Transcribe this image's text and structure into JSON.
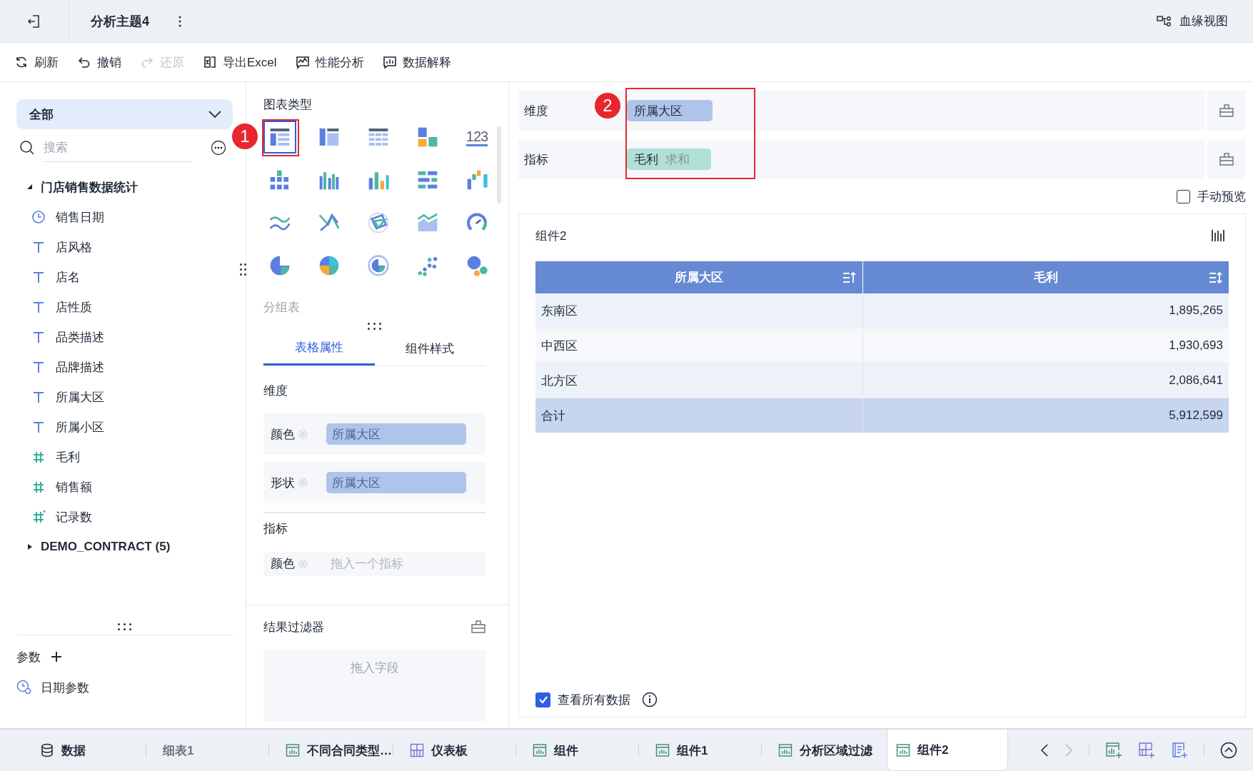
{
  "header": {
    "title": "分析主题4",
    "lineage_label": "血缘视图"
  },
  "toolbar": [
    {
      "label": "刷新",
      "kind": "refresh",
      "disabled": false
    },
    {
      "label": "撤销",
      "kind": "undo",
      "disabled": false
    },
    {
      "label": "还原",
      "kind": "redo",
      "disabled": true
    },
    {
      "label": "导出Excel",
      "kind": "excel",
      "disabled": false
    },
    {
      "label": "性能分析",
      "kind": "performance",
      "disabled": false
    },
    {
      "label": "数据解释",
      "kind": "explain",
      "disabled": false
    }
  ],
  "data_panel": {
    "scope": "全部",
    "search_placeholder": "搜索",
    "datasets": [
      {
        "name": "门店销售数据统计",
        "expanded": true,
        "children": [
          {
            "name": "销售日期",
            "kind": "date"
          },
          {
            "name": "店风格",
            "kind": "text"
          },
          {
            "name": "店名",
            "kind": "text"
          },
          {
            "name": "店性质",
            "kind": "text"
          },
          {
            "name": "品类描述",
            "kind": "text"
          },
          {
            "name": "品牌描述",
            "kind": "text"
          },
          {
            "name": "所属大区",
            "kind": "text"
          },
          {
            "name": "所属小区",
            "kind": "text"
          },
          {
            "name": "毛利",
            "kind": "number"
          },
          {
            "name": "销售额",
            "kind": "number"
          },
          {
            "name": "记录数",
            "kind": "count"
          }
        ]
      },
      {
        "name": "DEMO_CONTRACT (5)",
        "expanded": false
      }
    ],
    "params_label": "参数",
    "params": [
      {
        "name": "日期参数",
        "kind": "date"
      }
    ]
  },
  "chart_types": {
    "title": "图表类型",
    "hint": "分组表",
    "items": [
      {
        "kind": "table",
        "selected": true
      },
      {
        "kind": "crosstab",
        "selected": false
      },
      {
        "kind": "grid",
        "selected": false
      },
      {
        "kind": "blocks",
        "selected": false
      },
      {
        "kind": "kpi",
        "glyph": "123",
        "selected": false
      },
      {
        "kind": "stacked-bar",
        "selected": false
      },
      {
        "kind": "grouped-bar",
        "selected": false
      },
      {
        "kind": "bar",
        "selected": false
      },
      {
        "kind": "hbar",
        "selected": false
      },
      {
        "kind": "waterfall",
        "selected": false
      },
      {
        "kind": "line",
        "selected": false
      },
      {
        "kind": "cross-line",
        "selected": false
      },
      {
        "kind": "radar",
        "selected": false
      },
      {
        "kind": "area",
        "selected": false
      },
      {
        "kind": "gauge",
        "selected": false
      },
      {
        "kind": "pie",
        "selected": false
      },
      {
        "kind": "multi-pie",
        "selected": false
      },
      {
        "kind": "donut",
        "selected": false
      },
      {
        "kind": "scatter",
        "selected": false
      },
      {
        "kind": "bubble",
        "selected": false
      }
    ]
  },
  "property_tabs": [
    {
      "label": "表格属性",
      "selected": true
    },
    {
      "label": "组件样式",
      "selected": false
    }
  ],
  "properties": {
    "dimension_title": "维度",
    "dimension_slots": [
      {
        "label": "颜色",
        "field": "所属大区"
      },
      {
        "label": "形状",
        "field": "所属大区"
      }
    ],
    "measure_title": "指标",
    "measure_slots": [
      {
        "label": "颜色",
        "placeholder": "拖入一个指标"
      }
    ]
  },
  "result_filter": {
    "title": "结果过滤器",
    "placeholder": "拖入字段"
  },
  "shelves": [
    {
      "label": "维度",
      "fields": [
        {
          "name": "所属大区",
          "kind": "dimension"
        }
      ]
    },
    {
      "label": "指标",
      "fields": [
        {
          "name": "毛利",
          "aggregation": "求和",
          "kind": "measure"
        }
      ]
    }
  ],
  "manual_preview": {
    "label": "手动预览",
    "checked": false
  },
  "widget": {
    "title": "组件2",
    "columns": [
      {
        "label": "所属大区",
        "kind": "sorted"
      },
      {
        "label": "毛利",
        "kind": "sortable"
      }
    ],
    "rows": [
      {
        "kind": "data",
        "cells": [
          "东南区",
          "1,895,265"
        ]
      },
      {
        "kind": "data",
        "cells": [
          "中西区",
          "1,930,693"
        ]
      },
      {
        "kind": "data",
        "cells": [
          "北方区",
          "2,086,641"
        ]
      },
      {
        "kind": "total",
        "cells": [
          "合计",
          "5,912,599"
        ]
      }
    ],
    "view_all": {
      "label": "查看所有数据",
      "checked": true
    }
  },
  "annotations": [
    {
      "label": "1"
    },
    {
      "label": "2"
    }
  ],
  "bottom_tabs": [
    {
      "label": "数据",
      "kind": "data",
      "selected": false
    },
    {
      "label": "细表1",
      "kind": "faded",
      "selected": false
    },
    {
      "label": "不同合同类型…",
      "kind": "chart",
      "selected": false
    },
    {
      "label": "仪表板",
      "kind": "dashboard",
      "selected": false
    },
    {
      "label": "组件",
      "kind": "chart",
      "selected": false
    },
    {
      "label": "组件1",
      "kind": "chart",
      "selected": false
    },
    {
      "label": "分析区域过滤",
      "kind": "chart",
      "selected": false
    },
    {
      "label": "组件2",
      "kind": "chart",
      "selected": true
    }
  ]
}
